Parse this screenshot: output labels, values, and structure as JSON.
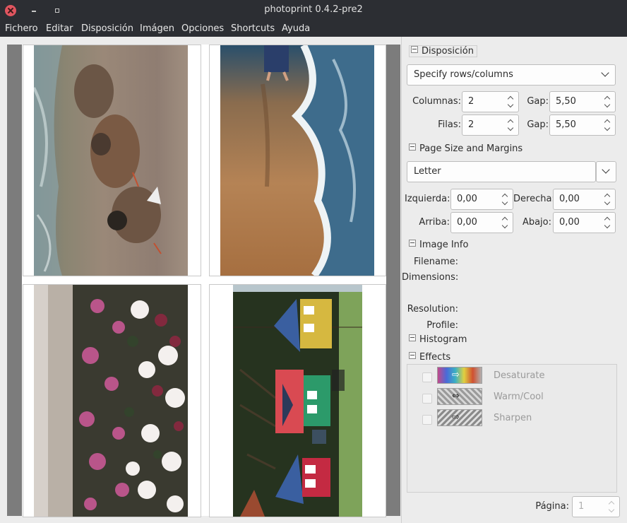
{
  "window": {
    "title": "photoprint 0.4.2-pre2"
  },
  "menu": [
    "Fichero",
    "Editar",
    "Disposición",
    "Imágen",
    "Opciones",
    "Shortcuts",
    "Ayuda"
  ],
  "layout": {
    "heading": "Disposición",
    "mode": "Specify rows/columns",
    "columns_label": "Columnas:",
    "columns_value": "2",
    "rows_label": "Filas:",
    "rows_value": "2",
    "gap_label": "Gap:",
    "gap_col_value": "5,50",
    "gap_row_value": "5,50"
  },
  "page_size": {
    "heading": "Page Size and Margins",
    "paper": "Letter",
    "left_label": "Izquierda:",
    "left_value": "0,00",
    "right_label": "Derecha:",
    "right_value": "0,00",
    "top_label": "Arriba:",
    "top_value": "0,00",
    "bottom_label": "Abajo:",
    "bottom_value": "0,00"
  },
  "image_info": {
    "heading": "Image Info",
    "filename_label": "Filename:",
    "dimensions_label": "Dimensions:",
    "resolution_label": "Resolution:",
    "profile_label": "Profile:"
  },
  "histogram": {
    "heading": "Histogram"
  },
  "effects": {
    "heading": "Effects",
    "items": [
      {
        "label": "Desaturate",
        "icon": "desaturate-icon"
      },
      {
        "label": "Warm/Cool",
        "icon": "warm-cool-icon"
      },
      {
        "label": "Sharpen",
        "icon": "sharpen-icon"
      }
    ]
  },
  "pagination": {
    "label": "Página:",
    "value": "1"
  },
  "photos": [
    {
      "name": "photo-ducks"
    },
    {
      "name": "photo-beach"
    },
    {
      "name": "photo-flowers"
    },
    {
      "name": "photo-houses"
    }
  ]
}
